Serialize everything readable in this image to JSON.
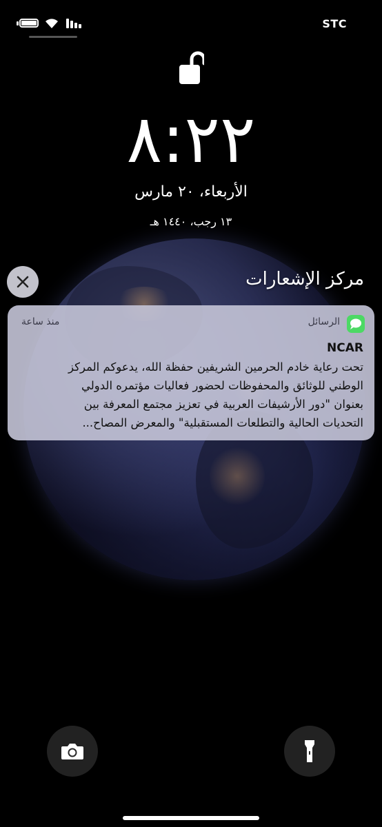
{
  "status_bar": {
    "carrier": "STC",
    "battery_icon": "battery-icon",
    "wifi_icon": "wifi-icon",
    "signal_icon": "cellular-signal-icon"
  },
  "lock_screen": {
    "lock_icon": "unlocked-padlock-icon",
    "time": "٨:٢٢",
    "date": "الأربعاء، ٢٠ مارس",
    "hijri_date": "١٣ رجب، ١٤٤٠ هـ"
  },
  "notification_center": {
    "title": "مركز الإشعارات",
    "close_icon": "close-icon"
  },
  "notification": {
    "app_icon": "messages-icon",
    "app_color": "#4cd964",
    "app_name": "الرسائل",
    "time": "منذ ساعة",
    "sender": "NCAR",
    "body_lines": [
      "تحت رعاية خادم الحرمين الشريفين حفظة الله، يدعوكم المركز",
      "الوطني للوثائق والمحفوظات لحضور فعاليات مؤتمره الدولي",
      "بعنوان \"دور الأرشيفات العربية في تعزيز مجتمع المعرفة بين",
      "التحديات الحالية والتطلعات المستقبلية\" والمعرض المصاح..."
    ]
  },
  "controls": {
    "flashlight_icon": "flashlight-icon",
    "camera_icon": "camera-icon"
  }
}
